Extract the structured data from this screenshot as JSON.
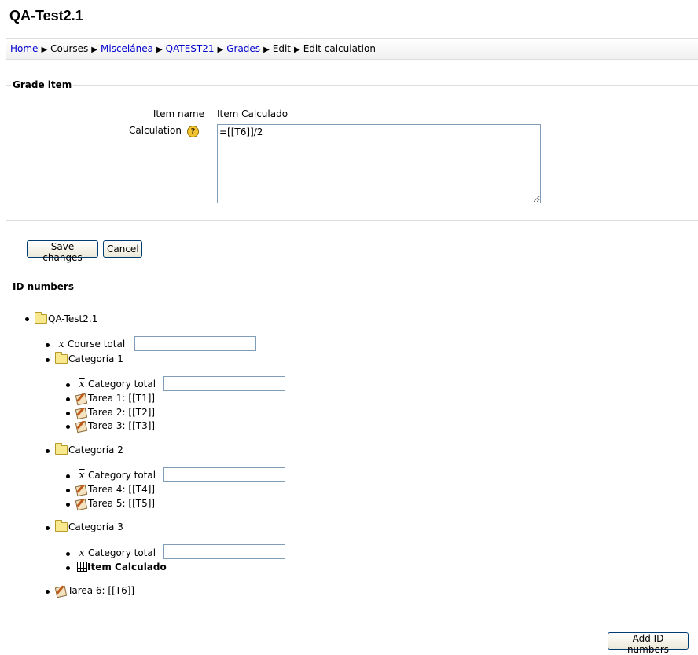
{
  "page": {
    "title": "QA-Test2.1"
  },
  "breadcrumb": {
    "items": [
      {
        "label": "Home",
        "link": true
      },
      {
        "label": "Courses",
        "link": false
      },
      {
        "label": "Miscelánea",
        "link": true
      },
      {
        "label": "QATEST21",
        "link": true
      },
      {
        "label": "Grades",
        "link": true
      },
      {
        "label": "Edit",
        "link": false
      },
      {
        "label": "Edit calculation",
        "link": false
      }
    ],
    "separator": "▶"
  },
  "grade_item": {
    "legend": "Grade item",
    "item_name_label": "Item name",
    "item_name_value": "Item Calculado",
    "calculation_label": "Calculation",
    "help_glyph": "?",
    "calculation_value": "=[[T6]]/2"
  },
  "buttons": {
    "save": "Save changes",
    "cancel": "Cancel",
    "add_id_numbers": "Add ID numbers"
  },
  "id_numbers": {
    "legend": "ID numbers",
    "root": "QA-Test2.1",
    "course_total": "Course total",
    "categories": [
      {
        "name": "Categoría 1",
        "total": "Category total",
        "items": [
          "Tarea 1: [[T1]]",
          "Tarea 2: [[T2]]",
          "Tarea 3: [[T3]]"
        ]
      },
      {
        "name": "Categoría 2",
        "total": "Category total",
        "items": [
          "Tarea 4: [[T4]]",
          "Tarea 5: [[T5]]"
        ]
      },
      {
        "name": "Categoría 3",
        "total": "Category total",
        "calc_item": "Item Calculado"
      }
    ],
    "loose_item": "Tarea 6: [[T6]]"
  }
}
